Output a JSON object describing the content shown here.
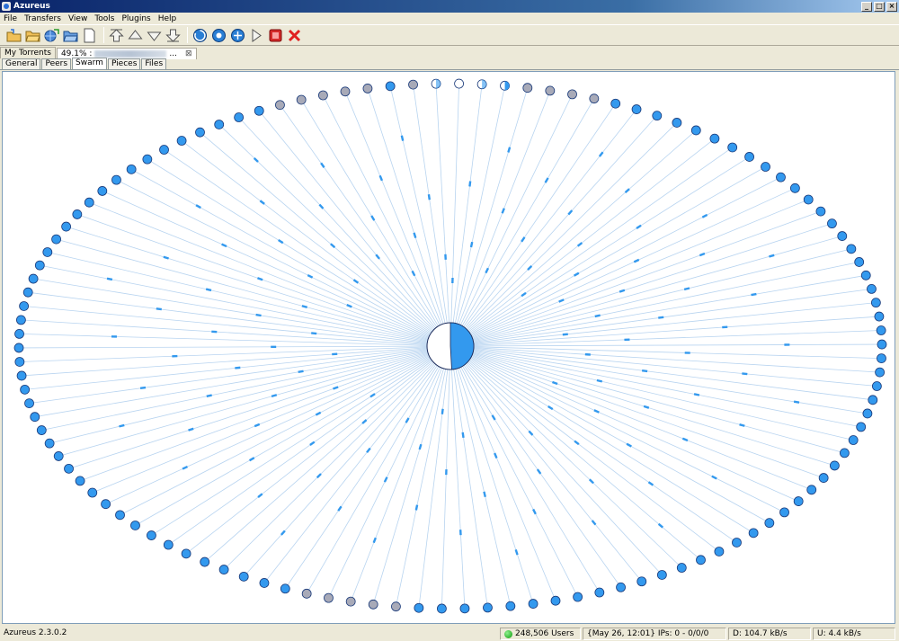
{
  "window": {
    "title": "Azureus",
    "minimize": "_",
    "maximize": "□",
    "close": "×"
  },
  "menu": [
    "File",
    "Transfers",
    "View",
    "Tools",
    "Plugins",
    "Help"
  ],
  "toolbar": {
    "buttons": [
      {
        "icon": "open-torrent-icon",
        "color": "#e8b54a"
      },
      {
        "icon": "open-folder-icon",
        "color": "#e8b54a"
      },
      {
        "icon": "open-url-icon",
        "color": "#4a86d6"
      },
      {
        "icon": "open-folder-blue-icon",
        "color": "#4a86d6"
      },
      {
        "icon": "new-document-icon",
        "color": "#ffffff"
      },
      {
        "icon": "move-top-icon",
        "color": "#d4d0c8"
      },
      {
        "icon": "move-up-icon",
        "color": "#d4d0c8"
      },
      {
        "icon": "move-down-icon",
        "color": "#d4d0c8"
      },
      {
        "icon": "move-bottom-icon",
        "color": "#d4d0c8"
      },
      {
        "icon": "run-icon",
        "color": "#2a7fd4"
      },
      {
        "icon": "start-icon",
        "color": "#2a7fd4"
      },
      {
        "icon": "host-icon",
        "color": "#2a7fd4"
      },
      {
        "icon": "publish-icon",
        "color": "#d4d0c8"
      },
      {
        "icon": "stop-icon",
        "color": "#d42a2a"
      },
      {
        "icon": "remove-icon",
        "color": "#e02020"
      }
    ]
  },
  "views": {
    "my_torrents": "My Torrents",
    "active_torrent_percent": "49.1% :",
    "close_symbol": "⊠"
  },
  "tabs": [
    "General",
    "Peers",
    "Swarm",
    "Pieces",
    "Files"
  ],
  "active_tab": "Swarm",
  "swarm": {
    "center_progress": 0.491,
    "peer_color": "#3399ee",
    "inactive_color": "#a8aab8",
    "line_color": "#b8d4f0"
  },
  "status": {
    "version": "Azureus 2.3.0.2",
    "users": "248,506 Users",
    "ips": "{May 26, 12:01} IPs: 0 - 0/0/0",
    "download": "D: 104.7 kB/s",
    "upload": "U: 4.4 kB/s"
  }
}
